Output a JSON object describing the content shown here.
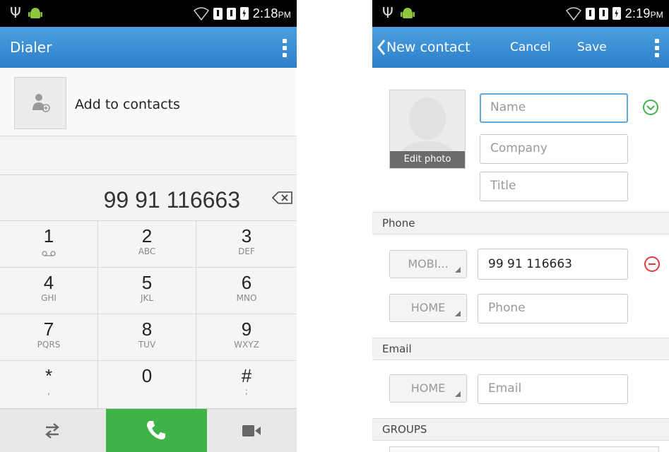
{
  "left": {
    "status_time": "2:18",
    "status_ampm": "PM",
    "title": "Dialer",
    "add_to_contacts": "Add to contacts",
    "dialed_number": "99 91 116663",
    "keys": [
      {
        "digit": "1",
        "letters": "o_o"
      },
      {
        "digit": "2",
        "letters": "ABC"
      },
      {
        "digit": "3",
        "letters": "DEF"
      },
      {
        "digit": "4",
        "letters": "GHI"
      },
      {
        "digit": "5",
        "letters": "JKL"
      },
      {
        "digit": "6",
        "letters": "MNO"
      },
      {
        "digit": "7",
        "letters": "PQRS"
      },
      {
        "digit": "8",
        "letters": "TUV"
      },
      {
        "digit": "9",
        "letters": "WXYZ"
      },
      {
        "digit": "*",
        "letters": ","
      },
      {
        "digit": "0",
        "letters": ""
      },
      {
        "digit": "#",
        "letters": ";"
      }
    ],
    "icons": [
      "usb-icon",
      "android-icon",
      "wifi-icon",
      "sim-icon",
      "battery-icon",
      "overflow-menu-icon",
      "add-contact-icon",
      "backspace-icon",
      "voicemail-icon",
      "swap-icon",
      "call-icon",
      "video-call-icon"
    ]
  },
  "right": {
    "status_time": "2:19",
    "status_ampm": "PM",
    "title": "New contact",
    "cancel": "Cancel",
    "save": "Save",
    "edit_photo": "Edit photo",
    "name_placeholder": "Name",
    "company_placeholder": "Company",
    "title_placeholder": "Title",
    "phone_section": "Phone",
    "phone_type_1": "MOBI...",
    "phone_value_1": "99 91 116663",
    "phone_type_2": "HOME",
    "phone_placeholder_2": "Phone",
    "email_section": "Email",
    "email_type": "HOME",
    "email_placeholder": "Email",
    "groups_section": "GROUPS",
    "colors": {
      "accent": "#2e7fc9",
      "confirm": "#3fb24a",
      "remove": "#e0393e"
    }
  }
}
